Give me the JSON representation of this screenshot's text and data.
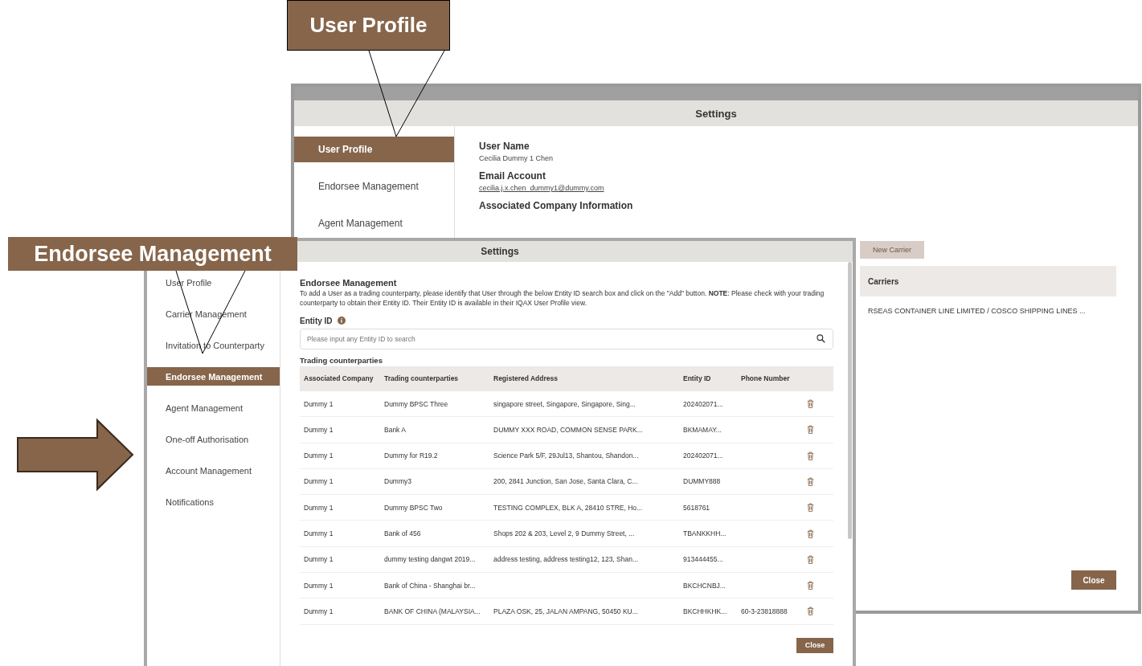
{
  "callouts": [
    {
      "label": "User Profile"
    },
    {
      "label": "Endorsee Management"
    }
  ],
  "back_dialog": {
    "title": "Settings",
    "menu": [
      {
        "label": "User Profile",
        "selected": true
      },
      {
        "label": "Endorsee Management",
        "selected": false
      },
      {
        "label": "Agent Management",
        "selected": false
      }
    ],
    "fields": [
      {
        "label": "User Name",
        "value": "Cecilia Dummy 1 Chen",
        "kind": "text"
      },
      {
        "label": "Email Account",
        "value": "cecilia.j.x.chen_dummy1@dummy.com",
        "kind": "link"
      }
    ],
    "section": "Associated Company Information",
    "add_button": "New Carrier",
    "carriers_header": "Carriers",
    "carrier_row": "RSEAS CONTAINER LINE LIMITED / COSCO SHIPPING LINES ...",
    "close": "Close"
  },
  "dialog": {
    "title": "Settings",
    "menu": [
      {
        "label": "User Profile",
        "selected": false
      },
      {
        "label": "Carrier Management",
        "selected": false
      },
      {
        "label": "Invitation to Counterparty",
        "selected": false
      },
      {
        "label": "Endorsee Management",
        "selected": true
      },
      {
        "label": "Agent Management",
        "selected": false
      },
      {
        "label": "One-off Authorisation",
        "selected": false
      },
      {
        "label": "Account Management",
        "selected": false
      },
      {
        "label": "Notifications",
        "selected": false
      }
    ],
    "heading": "Endorsee Management",
    "description": "To add a User as a trading counterparty, please identify that User through the below Entity ID search box and click on the \"Add\" button. **NOTE**: Please check with your trading counterparty to obtain their Entity ID. Their Entity ID is available in their IQAX User Profile view.",
    "entity_label": "Entity ID",
    "search": {
      "placeholder": "Please input any Entity ID to search"
    },
    "table_title": "Trading counterparties",
    "columns": [
      "Associated Company",
      "Trading counterparties",
      "Registered Address",
      "Entity ID",
      "Phone Number"
    ],
    "rows": [
      [
        "Dummy 1",
        "Dummy BPSC Three",
        "singapore street, Singapore, Singapore, Sing...",
        "202402071...",
        ""
      ],
      [
        "Dummy 1",
        "Bank A",
        "DUMMY XXX ROAD, COMMON SENSE PARK...",
        "BKMAMAY...",
        ""
      ],
      [
        "Dummy 1",
        "Dummy for R19.2",
        "Science Park 5/F, 29Jul13, Shantou, Shandon...",
        "202402071...",
        ""
      ],
      [
        "Dummy 1",
        "Dummy3",
        "200, 2841 Junction, San Jose, Santa Clara, C...",
        "DUMMY888",
        ""
      ],
      [
        "Dummy 1",
        "Dummy BPSC Two",
        "TESTING COMPLEX, BLK A, 28410 STRE, Ho...",
        "5618761",
        ""
      ],
      [
        "Dummy 1",
        "Bank of 456",
        "Shops 202 & 203, Level 2, 9 Dummy Street, ...",
        "TBANKKHH...",
        ""
      ],
      [
        "Dummy 1",
        "dummy testing dangwt 2019...",
        "address testing, address testing12, 123, Shan...",
        "913444455...",
        ""
      ],
      [
        "Dummy 1",
        "Bank of China - Shanghai br...",
        "",
        "BKCHCNBJ...",
        ""
      ],
      [
        "Dummy 1",
        "BANK OF CHINA (MALAYSIA...",
        "PLAZA OSK, 25, JALAN AMPANG, 50450 KU...",
        "BKCHHKHK...",
        "60-3-23818888"
      ]
    ],
    "close": "Close"
  }
}
